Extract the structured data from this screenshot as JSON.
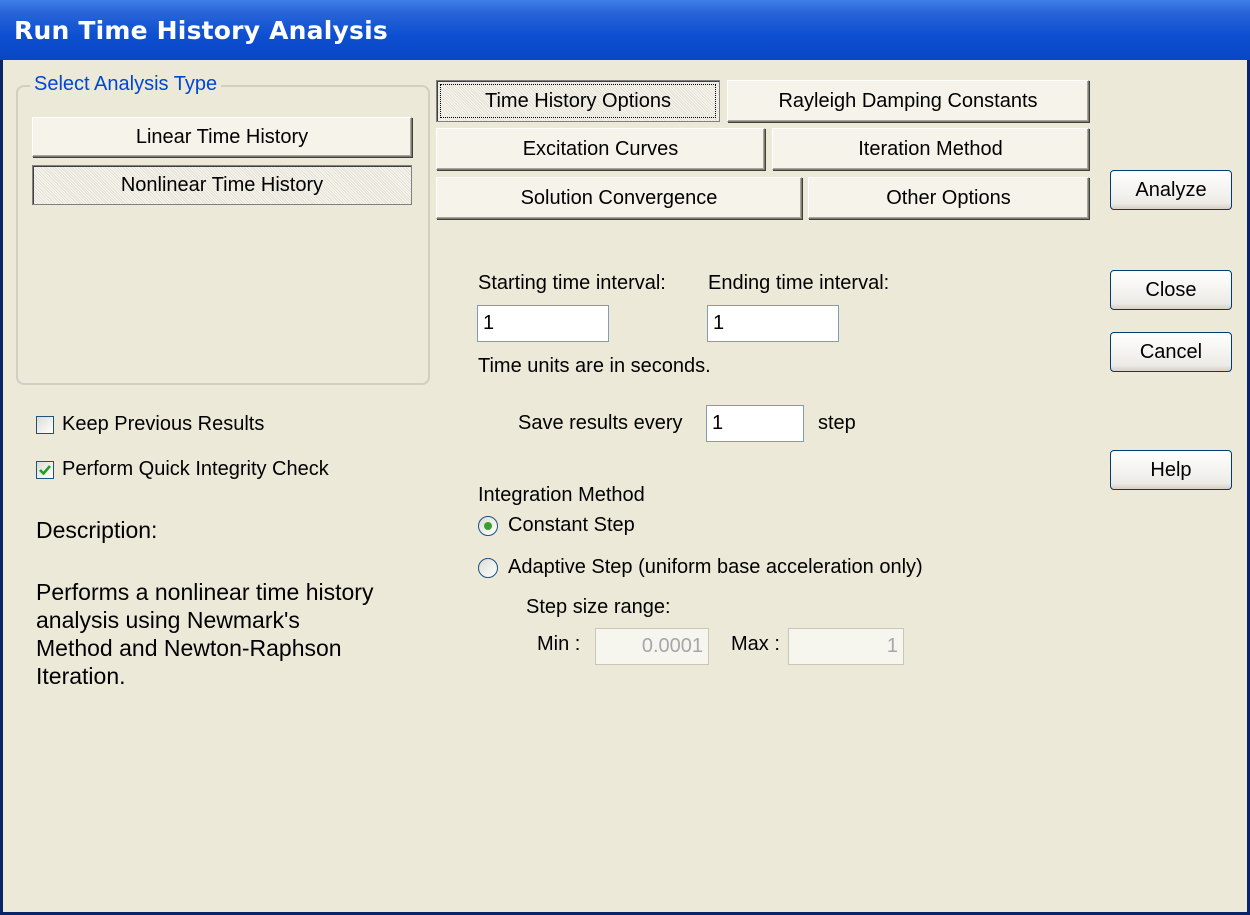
{
  "window": {
    "title": "Run Time History Analysis"
  },
  "analysis_type": {
    "legend": "Select Analysis Type",
    "buttons": [
      {
        "label": "Linear Time History",
        "selected": false
      },
      {
        "label": "Nonlinear Time History",
        "selected": true
      }
    ]
  },
  "tabs": [
    {
      "label": "Time History Options",
      "active": true
    },
    {
      "label": "Rayleigh Damping Constants"
    },
    {
      "label": "Excitation Curves"
    },
    {
      "label": "Iteration Method"
    },
    {
      "label": "Solution Convergence"
    },
    {
      "label": "Other Options"
    }
  ],
  "actions": {
    "analyze": "Analyze",
    "close": "Close",
    "cancel": "Cancel",
    "help": "Help"
  },
  "options": {
    "keep_previous_results": {
      "label": "Keep Previous Results",
      "checked": false
    },
    "quick_integrity_check": {
      "label": "Perform Quick Integrity Check",
      "checked": true
    }
  },
  "description": {
    "title": "Description:",
    "lines": [
      "Performs a nonlinear time history",
      "analysis using Newmark's",
      "Method and Newton-Raphson",
      "Iteration."
    ]
  },
  "time_history": {
    "starting_label": "Starting time interval:",
    "starting_value": "1",
    "ending_label": "Ending time interval:",
    "ending_value": "1",
    "units_note": "Time units are in seconds.",
    "save_prefix": "Save results every",
    "save_value": "1",
    "save_suffix": "step"
  },
  "integration": {
    "title": "Integration Method",
    "constant_step": {
      "label": "Constant Step",
      "selected": true
    },
    "adaptive_step": {
      "label": "Adaptive Step (uniform base acceleration only)",
      "selected": false
    },
    "step_range_label": "Step size range:",
    "min_label": "Min :",
    "min_value": "0.0001",
    "max_label": "Max :",
    "max_value": "1"
  },
  "colors": {
    "title_bar": "#0a46c4",
    "dialog_bg": "#ece9d8",
    "legend_text": "#0046d5",
    "check_green": "#21a121"
  },
  "icons": {
    "checkbox_check": "check-mark-icon",
    "radio_selected": "radio-dot-icon"
  }
}
